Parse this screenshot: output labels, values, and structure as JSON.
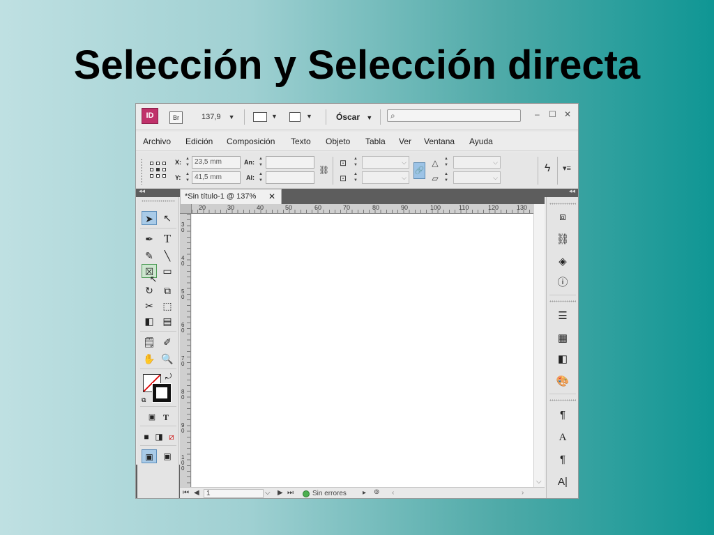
{
  "slide": {
    "title": "Selección y Selección directa"
  },
  "titlebar": {
    "app_logo": "ID",
    "bridge_logo": "Br",
    "zoom_value": "137,9",
    "user_name": "Óscar",
    "search_placeholder": "",
    "window_controls": [
      "–",
      "☐",
      "✕"
    ]
  },
  "menubar": {
    "items": [
      "Archivo",
      "Edición",
      "Composición",
      "Texto",
      "Objeto",
      "Tabla",
      "Ver",
      "Ventana",
      "Ayuda"
    ]
  },
  "control_panel": {
    "x_label": "X:",
    "y_label": "Y:",
    "x_value": "23,5 mm",
    "y_value": "41,5 mm",
    "w_label": "An:",
    "h_label": "Al:",
    "w_value": "",
    "h_value": ""
  },
  "document": {
    "tab_title": "*Sin título-1 @ 137%",
    "ruler_top": [
      "20",
      "30",
      "40",
      "50",
      "60",
      "70",
      "80",
      "90",
      "100",
      "110",
      "120",
      "130"
    ],
    "ruler_left": [
      "3\n0",
      "4\n0",
      "5\n0",
      "6\n0",
      "7\n0",
      "8\n0",
      "9\n0",
      "1\n0\n0"
    ]
  },
  "statusbar": {
    "page_value": "1",
    "preflight_status": "Sin errores"
  },
  "tools": {
    "selected": "rectangle-frame-tool"
  },
  "icons": {
    "selection_tool": "selection-arrow-icon",
    "direct_selection_tool": "direct-selection-arrow-icon",
    "pen_tool": "pen-icon",
    "type_tool": "type-icon"
  },
  "colors": {
    "app_logo_bg": "#c0316a",
    "selected_tool_bg": "#a9cbe8",
    "status_ok": "#4caf50"
  }
}
